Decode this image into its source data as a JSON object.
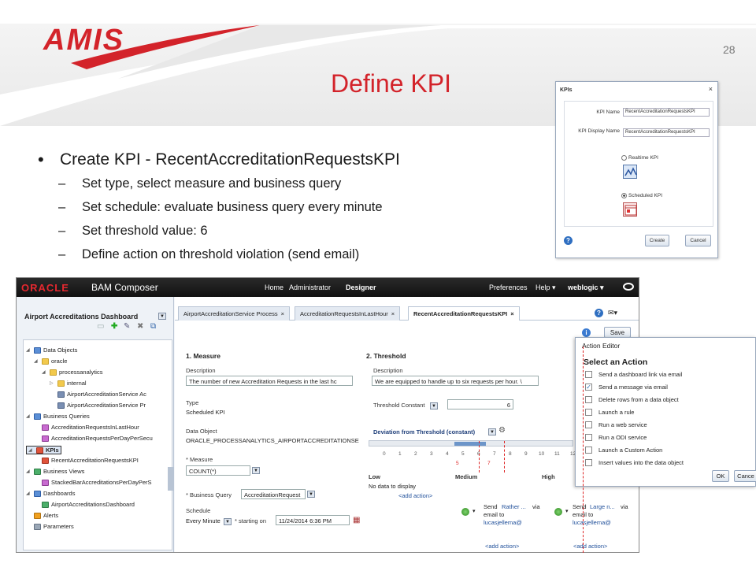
{
  "slide": {
    "logo": "AMIS",
    "page_number": "28",
    "title": "Define KPI",
    "bullet_main": "Create KPI - RecentAccreditationRequestsKPI",
    "bullets_sub": [
      "Set type, select measure and business query",
      "Set schedule: evaluate business query every minute",
      "Set threshold value: 6",
      "Define action on threshold violation (send email)"
    ],
    "colors": {
      "accent": "#d3232a"
    }
  },
  "kpi_dialog": {
    "title": "KPIs",
    "close": "×",
    "kpi_name_label": "KPI Name",
    "kpi_name_value": "RecentAccreditationRequestsKPI",
    "kpi_display_label": "KPI Display Name",
    "kpi_display_value": "RecentAccreditationRequestsKPI",
    "realtime_label": "Realtime KPI",
    "scheduled_label": "Scheduled KPI",
    "selected": "Scheduled KPI",
    "help": "?",
    "create_button": "Create",
    "cancel_button": "Cancel"
  },
  "bam": {
    "brand": "ORACLE",
    "app_name": "BAM Composer",
    "nav": [
      "Home",
      "Administrator",
      "Designer"
    ],
    "nav_right": [
      "Preferences",
      "Help ▾",
      "weblogic ▾"
    ],
    "dashboard_title": "Airport Accreditations Dashboard",
    "tree": [
      {
        "label": "Data Objects"
      },
      {
        "label": "oracle"
      },
      {
        "label": "processanalytics"
      },
      {
        "label": "internal"
      },
      {
        "label": "AirportAccreditationService Ac"
      },
      {
        "label": "AirportAccreditationService Pr"
      },
      {
        "label": "Business Queries"
      },
      {
        "label": "AccreditationRequestsInLastHour"
      },
      {
        "label": "AccreditationRequestsPerDayPerSecu"
      },
      {
        "label": "KPIs"
      },
      {
        "label": "RecentAccreditationRequestsKPI"
      },
      {
        "label": "Business Views"
      },
      {
        "label": "StackedBarAccreditationsPerDayPerS"
      },
      {
        "label": "Dashboards"
      },
      {
        "label": "AirportAccreditationsDashboard"
      },
      {
        "label": "Alerts"
      },
      {
        "label": "Parameters"
      }
    ],
    "tabs": [
      {
        "label": "AirportAccreditationService Process"
      },
      {
        "label": "AccreditationRequestsInLastHour"
      },
      {
        "label": "RecentAccreditationRequestsKPI"
      }
    ],
    "tab_close": "×",
    "save_button": "Save",
    "measure": {
      "heading": "1. Measure",
      "description_label": "Description",
      "description_value": "The number of new Accreditation Requests in the last hc",
      "type_label": "Type",
      "type_value": "Scheduled KPI",
      "data_object_label": "Data Object",
      "data_object_value": "ORACLE_PROCESSANALYTICS_AIRPORTACCREDITATIONSE",
      "measure_label": "* Measure",
      "measure_value": "COUNT(*)",
      "business_query_label": "* Business Query",
      "business_query_value": "AccreditationRequest",
      "schedule_label": "Schedule",
      "schedule_value": "Every Minute",
      "starting_on_label": "* starting on",
      "starting_on_value": "11/24/2014 6:36 PM"
    },
    "threshold": {
      "heading": "2. Threshold",
      "description_label": "Description",
      "description_value": "We are equipped to handle up to six requests per hour. \\",
      "constant_label": "Threshold Constant",
      "constant_value": "6",
      "deviation_label": "Deviation from Threshold (constant)",
      "ticks": [
        "0",
        "1",
        "2",
        "3",
        "4",
        "5",
        "6",
        "7",
        "8",
        "9",
        "10",
        "11",
        "12"
      ],
      "marker_low": "5",
      "marker_high": "7",
      "low_label": "Low",
      "medium_label": "Medium",
      "high_label": "High",
      "no_data": "No data to display",
      "add_action": "<add action>",
      "send_label": "Send",
      "med_msg": "Rather ...",
      "high_msg": "Large n...",
      "via": "via",
      "email_to": "email to",
      "recipient": "lucasjellema@"
    }
  },
  "action_editor": {
    "title": "Action Editor",
    "subtitle": "Select an Action",
    "actions": [
      {
        "label": "Send a dashboard link via email",
        "checked": ""
      },
      {
        "label": "Send a message via email",
        "checked": "✓"
      },
      {
        "label": "Delete rows from a data object",
        "checked": ""
      },
      {
        "label": "Launch a rule",
        "checked": ""
      },
      {
        "label": "Run a web service",
        "checked": ""
      },
      {
        "label": "Run a ODI service",
        "checked": ""
      },
      {
        "label": "Launch a Custom Action",
        "checked": ""
      },
      {
        "label": "Insert values into the data object",
        "checked": ""
      }
    ],
    "ok_button": "OK",
    "cancel_button": "Cance"
  }
}
